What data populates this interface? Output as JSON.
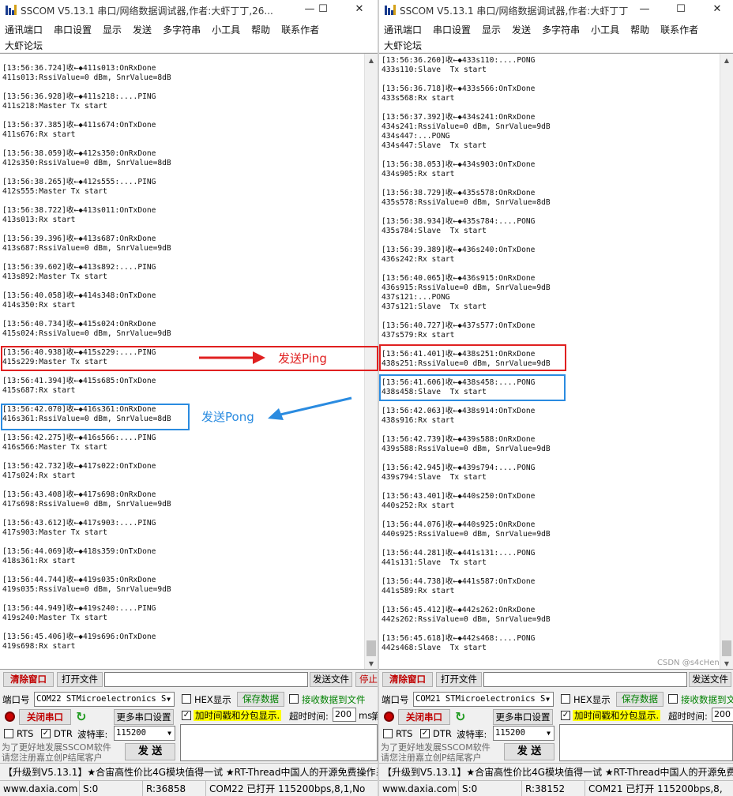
{
  "left": {
    "title": "SSCOM V5.13.1 串口/网络数据调试器,作者:大虾丁丁,26...",
    "menu": [
      "通讯端口",
      "串口设置",
      "显示",
      "发送",
      "多字符串",
      "小工具",
      "帮助",
      "联系作者"
    ],
    "menu2": "大虾论坛",
    "log": [
      "[13:56:36.724]收←◆411s013:OnRxDone",
      "411s013:RssiValue=0 dBm, SnrValue=8dB",
      "",
      "[13:56:36.928]收←◆411s218:....PING",
      "411s218:Master Tx start",
      "",
      "[13:56:37.385]收←◆411s674:OnTxDone",
      "411s676:Rx start",
      "",
      "[13:56:38.059]收←◆412s350:OnRxDone",
      "412s350:RssiValue=0 dBm, SnrValue=8dB",
      "",
      "[13:56:38.265]收←◆412s555:....PING",
      "412s555:Master Tx start",
      "",
      "[13:56:38.722]收←◆413s011:OnTxDone",
      "413s013:Rx start",
      "",
      "[13:56:39.396]收←◆413s687:OnRxDone",
      "413s687:RssiValue=0 dBm, SnrValue=9dB",
      "",
      "[13:56:39.602]收←◆413s892:....PING",
      "413s892:Master Tx start",
      "",
      "[13:56:40.058]收←◆414s348:OnTxDone",
      "414s350:Rx start",
      "",
      "[13:56:40.734]收←◆415s024:OnRxDone",
      "415s024:RssiValue=0 dBm, SnrValue=9dB",
      "",
      "[13:56:40.938]收←◆415s229:....PING",
      "415s229:Master Tx start",
      "",
      "[13:56:41.394]收←◆415s685:OnTxDone",
      "415s687:Rx start",
      "",
      "[13:56:42.070]收←◆416s361:OnRxDone",
      "416s361:RssiValue=0 dBm, SnrValue=8dB",
      "",
      "[13:56:42.275]收←◆416s566:....PING",
      "416s566:Master Tx start",
      "",
      "[13:56:42.732]收←◆417s022:OnTxDone",
      "417s024:Rx start",
      "",
      "[13:56:43.408]收←◆417s698:OnRxDone",
      "417s698:RssiValue=0 dBm, SnrValue=9dB",
      "",
      "[13:56:43.612]收←◆417s903:....PING",
      "417s903:Master Tx start",
      "",
      "[13:56:44.069]收←◆418s359:OnTxDone",
      "418s361:Rx start",
      "",
      "[13:56:44.744]收←◆419s035:OnRxDone",
      "419s035:RssiValue=0 dBm, SnrValue=9dB",
      "",
      "[13:56:44.949]收←◆419s240:....PING",
      "419s240:Master Tx start",
      "",
      "[13:56:45.406]收←◆419s696:OnTxDone",
      "419s698:Rx start"
    ],
    "controls": {
      "clear_btn": "清除窗口",
      "open_file_btn": "打开文件",
      "send_file_btn": "发送文件",
      "stop_btn": "停止",
      "port_label": "端口号",
      "port_value": "COM22 STMicroelectronics S",
      "hex_display": "HEX显示",
      "save_data": "保存数据",
      "recv_to_file": "接收数据到文件",
      "close_port_btn": "关闭串口",
      "more_settings": "更多串口设置",
      "timestamp_label": "加时间戳和分包显示.",
      "timeout_label": "超时时间:",
      "timeout_value": "200",
      "timeout_unit": "ms",
      "extra_label": "第",
      "rts": "RTS",
      "dtr": "DTR",
      "baud_label": "波特率:",
      "baud_value": "115200",
      "hint_line1": "为了更好地发展SSCOM软件",
      "hint_line2": "请您注册嘉立创P结尾客户",
      "send_btn": "发 送"
    },
    "adbar": "【升级到V5.13.1】★合宙高性价比4G模块值得一试 ★RT-Thread中国人的开源免费操作系",
    "status": [
      "www.daxia.com",
      "S:0",
      "R:36858",
      "COM22 已打开  115200bps,8,1,No"
    ]
  },
  "right": {
    "title": "SSCOM V5.13.1 串口/网络数据调试器,作者:大虾丁丁...",
    "menu": [
      "通讯端口",
      "串口设置",
      "显示",
      "发送",
      "多字符串",
      "小工具",
      "帮助",
      "联系作者"
    ],
    "menu2": "大虾论坛",
    "log": [
      "[13:56:36.260]收←◆433s110:....PONG",
      "433s110:Slave  Tx start",
      "",
      "[13:56:36.718]收←◆433s566:OnTxDone",
      "433s568:Rx start",
      "",
      "[13:56:37.392]收←◆434s241:OnRxDone",
      "434s241:RssiValue=0 dBm, SnrValue=9dB",
      "434s447:...PONG",
      "434s447:Slave  Tx start",
      "",
      "[13:56:38.053]收←◆434s903:OnTxDone",
      "434s905:Rx start",
      "",
      "[13:56:38.729]收←◆435s578:OnRxDone",
      "435s578:RssiValue=0 dBm, SnrValue=8dB",
      "",
      "[13:56:38.934]收←◆435s784:....PONG",
      "435s784:Slave  Tx start",
      "",
      "[13:56:39.389]收←◆436s240:OnTxDone",
      "436s242:Rx start",
      "",
      "[13:56:40.065]收←◆436s915:OnRxDone",
      "436s915:RssiValue=0 dBm, SnrValue=9dB",
      "437s121:...PONG",
      "437s121:Slave  Tx start",
      "",
      "[13:56:40.727]收←◆437s577:OnTxDone",
      "437s579:Rx start",
      "",
      "[13:56:41.401]收←◆438s251:OnRxDone",
      "438s251:RssiValue=0 dBm, SnrValue=9dB",
      "",
      "[13:56:41.606]收←◆438s458:....PONG",
      "438s458:Slave  Tx start",
      "",
      "[13:56:42.063]收←◆438s914:OnTxDone",
      "438s916:Rx start",
      "",
      "[13:56:42.739]收←◆439s588:OnRxDone",
      "439s588:RssiValue=0 dBm, SnrValue=9dB",
      "",
      "[13:56:42.945]收←◆439s794:....PONG",
      "439s794:Slave  Tx start",
      "",
      "[13:56:43.401]收←◆440s250:OnTxDone",
      "440s252:Rx start",
      "",
      "[13:56:44.076]收←◆440s925:OnRxDone",
      "440s925:RssiValue=0 dBm, SnrValue=9dB",
      "",
      "[13:56:44.281]收←◆441s131:....PONG",
      "441s131:Slave  Tx start",
      "",
      "[13:56:44.738]收←◆441s587:OnTxDone",
      "441s589:Rx start",
      "",
      "[13:56:45.412]收←◆442s262:OnRxDone",
      "442s262:RssiValue=0 dBm, SnrValue=9dB",
      "",
      "[13:56:45.618]收←◆442s468:....PONG",
      "442s468:Slave  Tx start"
    ],
    "controls": {
      "clear_btn": "清除窗口",
      "open_file_btn": "打开文件",
      "send_file_btn": "发送文件",
      "port_label": "端口号",
      "port_value": "COM21 STMicroelectronics S",
      "hex_display": "HEX显示",
      "save_data": "保存数据",
      "recv_to_file": "接收数据到文件",
      "close_port_btn": "关闭串口",
      "more_settings": "更多串口设置",
      "timestamp_label": "加时间戳和分包显示.",
      "timeout_label": "超时时间:",
      "timeout_value": "200",
      "rts": "RTS",
      "dtr": "DTR",
      "baud_label": "波特率:",
      "baud_value": "115200",
      "hint_line1": "为了更好地发展SSCOM软件",
      "hint_line2": "请您注册嘉立创P结尾客户",
      "send_btn": "发 送"
    },
    "adbar": "【升级到V5.13.1】★合宙高性价比4G模块值得一试 ★RT-Thread中国人的开源免费操",
    "status": [
      "www.daxia.com",
      "S:0",
      "R:38152",
      "COM21 已打开  115200bps,8,"
    ]
  },
  "annotations": {
    "ping_label": "发送Ping",
    "pong_label": "发送Pong",
    "watermark": "CSDN @s4cHen"
  },
  "window_buttons": {
    "minimize": "—",
    "maximize": "☐",
    "close": "✕"
  },
  "colors": {
    "red_annotation": "#e02020",
    "blue_annotation": "#2a8be0",
    "highlight": "#ffff00"
  }
}
